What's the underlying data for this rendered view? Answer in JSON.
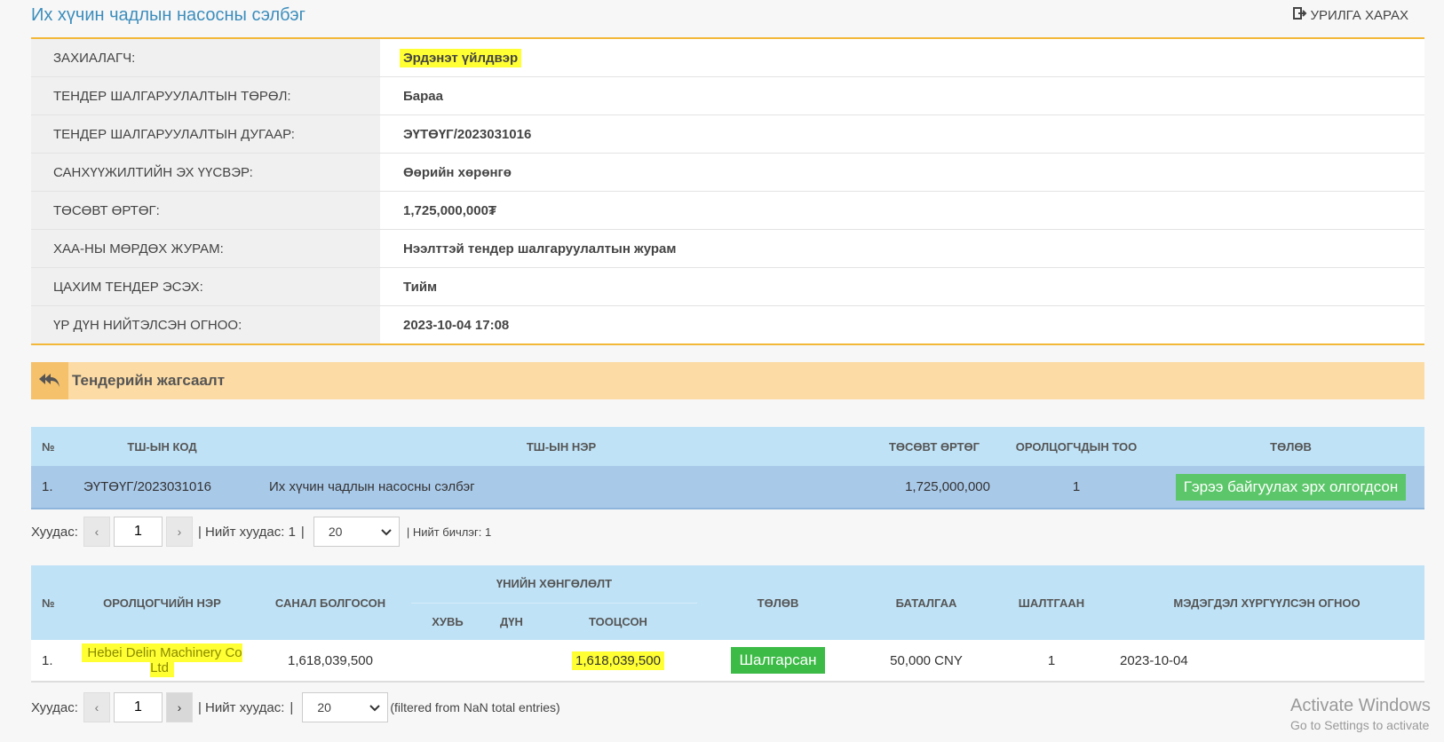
{
  "page": {
    "title": "Их хүчин чадлын насосны сэлбэг",
    "invite_label": "УРИЛГА ХАРАХ"
  },
  "info_rows": [
    {
      "label": "ЗАХИАЛАГЧ:",
      "value": "Эрдэнэт үйлдвэр"
    },
    {
      "label": "ТЕНДЕР ШАЛГАРУУЛАЛТЫН ТӨРӨЛ:",
      "value": "Бараа"
    },
    {
      "label": "ТЕНДЕР ШАЛГАРУУЛАЛТЫН ДУГААР:",
      "value": "ЭҮТӨҮГ/2023031016"
    },
    {
      "label": "САНХҮҮЖИЛТИЙН ЭХ ҮҮСВЭР:",
      "value": "Өөрийн хөрөнгө"
    },
    {
      "label": "ТӨСӨВТ ӨРТӨГ:",
      "value": "1,725,000,000₮"
    },
    {
      "label": "ХАА-НЫ МӨРДӨХ ЖУРАМ:",
      "value": "Нээлттэй тендер шалгаруулалтын журам"
    },
    {
      "label": "ЦАХИМ ТЕНДЕР ЭСЭХ:",
      "value": "Тийм"
    },
    {
      "label": "ҮР ДҮН НИЙТЭЛСЭН ОГНОО:",
      "value": "2023-10-04 17:08"
    }
  ],
  "tender_section": {
    "title": "Тендерийн жагсаалт",
    "headers": [
      "№",
      "ТШ-ЫН КОД",
      "ТШ-ЫН НЭР",
      "ТӨСӨВТ ӨРТӨГ",
      "ОРОЛЦОГЧДЫН ТОО",
      "ТӨЛӨВ"
    ],
    "rows": [
      {
        "num": "1.",
        "code": "ЭҮТӨҮГ/2023031016",
        "name": "Их хүчин чадлын насосны сэлбэг",
        "budget": "1,725,000,000",
        "participants": "1",
        "status": "Гэрээ байгуулах эрх олгогдсон"
      }
    ]
  },
  "pager1": {
    "page_label": "Хуудас:",
    "prev": "‹",
    "page_value": "1",
    "next": "›",
    "total_pages": "| Нийт хуудас: 1",
    "sep": "|",
    "page_size": "20",
    "total_records": "| Нийт бичлэг: 1"
  },
  "participants": {
    "headers": {
      "num": "№",
      "name": "ОРОЛЦОГЧИЙН НЭР",
      "offered": "САНАЛ БОЛГОСОН",
      "discount": "ҮНИЙН ХӨНГӨЛӨЛТ",
      "percent": "ХУВЬ",
      "amount": "ДҮН",
      "calculated": "ТООЦСОН",
      "status": "ТӨЛӨВ",
      "guarantee": "БАТАЛГАА",
      "reason": "ШАЛТГААН",
      "notice_date": "МЭДЭГДЭЛ ХҮРГҮҮЛСЭН ОГНОО"
    },
    "rows": [
      {
        "num": "1.",
        "name": "Hebei Delin Machinery Co Ltd",
        "offered": "1,618,039,500",
        "percent": "",
        "amount": "",
        "calculated": "1,618,039,500",
        "status": "Шалгарсан",
        "guarantee": "50,000 CNY",
        "reason": "1",
        "notice_date": "2023-10-04"
      }
    ]
  },
  "pager2": {
    "page_label": "Хуудас:",
    "prev": "‹",
    "page_value": "1",
    "next": "›",
    "total_pages": "| Нийт хуудас:",
    "sep": "|",
    "page_size": "20",
    "filtered": "(filtered from NaN total entries)"
  },
  "watermark": {
    "line1": "Activate Windows",
    "line2": "Go to Settings to activate"
  },
  "colors": {
    "accent": "#3c8dbc",
    "gold": "#f3b838",
    "tender_header": "#fcdba4",
    "table_header": "#bfe2f6",
    "status_green": "#5cc76a"
  }
}
